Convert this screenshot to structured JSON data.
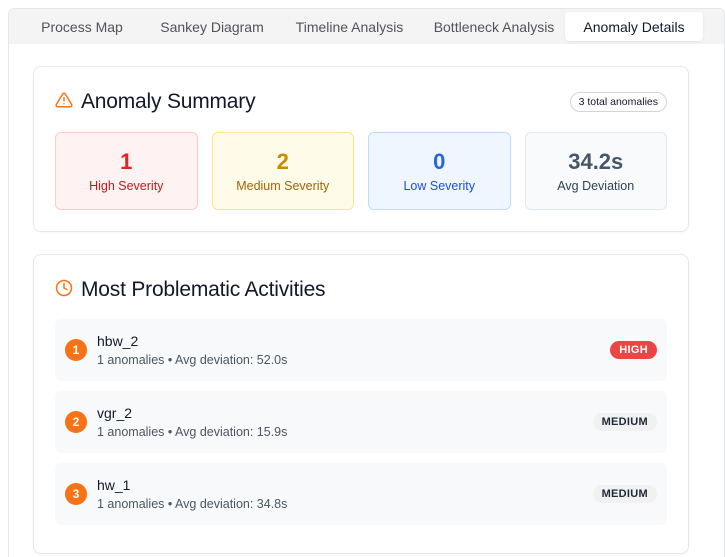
{
  "tabs": [
    {
      "label": "Process Map"
    },
    {
      "label": "Sankey Diagram"
    },
    {
      "label": "Timeline Analysis"
    },
    {
      "label": "Bottleneck Analysis"
    },
    {
      "label": "Anomaly Details",
      "active": true
    }
  ],
  "summary": {
    "title": "Anomaly Summary",
    "icon": "warning-triangle-icon",
    "total_badge": "3 total anomalies",
    "stats": {
      "high": {
        "value": "1",
        "label": "High Severity"
      },
      "medium": {
        "value": "2",
        "label": "Medium Severity"
      },
      "low": {
        "value": "0",
        "label": "Low Severity"
      },
      "avg": {
        "value": "34.2s",
        "label": "Avg Deviation"
      }
    }
  },
  "activities": {
    "title": "Most Problematic Activities",
    "icon": "clock-icon",
    "items": [
      {
        "rank": "1",
        "name": "hbw_2",
        "meta": "1 anomalies • Avg deviation: 52.0s",
        "severity": "HIGH"
      },
      {
        "rank": "2",
        "name": "vgr_2",
        "meta": "1 anomalies • Avg deviation: 15.9s",
        "severity": "MEDIUM"
      },
      {
        "rank": "3",
        "name": "hw_1",
        "meta": "1 anomalies • Avg deviation: 34.8s",
        "severity": "MEDIUM"
      }
    ]
  },
  "colors": {
    "accent": "#f97316",
    "high": "#dc2626",
    "medium": "#ca8a04",
    "low": "#2563eb"
  }
}
